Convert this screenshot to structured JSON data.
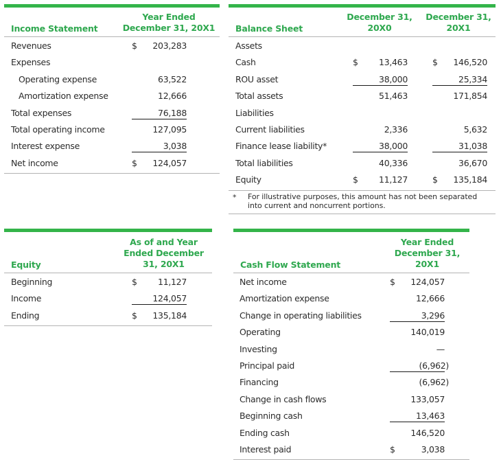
{
  "accent_color": "#34b44a",
  "income_statement": {
    "title": "Income Statement",
    "column_header": "Year Ended December 31, 20X1",
    "column_header_lines": [
      "Year Ended",
      "December 31, 20X1"
    ],
    "rows": [
      {
        "label": "Revenues",
        "currency": "$",
        "value": "203,283",
        "underline": false,
        "indent": false
      },
      {
        "label": "Expenses",
        "currency": "",
        "value": "",
        "underline": false,
        "indent": false
      },
      {
        "label": "Operating expense",
        "currency": "",
        "value": "63,522",
        "underline": false,
        "indent": true
      },
      {
        "label": "Amortization expense",
        "currency": "",
        "value": "12,666",
        "underline": false,
        "indent": true
      },
      {
        "label": "Total expenses",
        "currency": "",
        "value": "76,188",
        "underline": true,
        "indent": false
      },
      {
        "label": "Total operating income",
        "currency": "",
        "value": "127,095",
        "underline": false,
        "indent": false
      },
      {
        "label": "Interest expense",
        "currency": "",
        "value": "3,038",
        "underline": true,
        "indent": false
      },
      {
        "label": "Net income",
        "currency": "$",
        "value": "124,057",
        "underline": false,
        "indent": false
      }
    ]
  },
  "balance_sheet": {
    "title": "Balance Sheet",
    "column_headers": [
      {
        "lines": [
          "December 31,",
          "20X0"
        ]
      },
      {
        "lines": [
          "December 31,",
          "20X1"
        ]
      }
    ],
    "rows": [
      {
        "label": "Assets",
        "cells": [
          {
            "currency": "",
            "value": "",
            "underline": false
          },
          {
            "currency": "",
            "value": "",
            "underline": false
          }
        ]
      },
      {
        "label": "Cash",
        "cells": [
          {
            "currency": "$",
            "value": "13,463",
            "underline": false
          },
          {
            "currency": "$",
            "value": "146,520",
            "underline": false
          }
        ]
      },
      {
        "label": "ROU asset",
        "cells": [
          {
            "currency": "",
            "value": "38,000",
            "underline": true
          },
          {
            "currency": "",
            "value": "25,334",
            "underline": true
          }
        ]
      },
      {
        "label": "Total assets",
        "cells": [
          {
            "currency": "",
            "value": "51,463",
            "underline": false
          },
          {
            "currency": "",
            "value": "171,854",
            "underline": false
          }
        ]
      },
      {
        "label": "Liabilities",
        "cells": [
          {
            "currency": "",
            "value": "",
            "underline": false
          },
          {
            "currency": "",
            "value": "",
            "underline": false
          }
        ]
      },
      {
        "label": "Current liabilities",
        "cells": [
          {
            "currency": "",
            "value": "2,336",
            "underline": false
          },
          {
            "currency": "",
            "value": "5,632",
            "underline": false
          }
        ]
      },
      {
        "label": "Finance lease liability*",
        "cells": [
          {
            "currency": "",
            "value": "38,000",
            "underline": true
          },
          {
            "currency": "",
            "value": "31,038",
            "underline": true
          }
        ]
      },
      {
        "label": "Total liabilities",
        "cells": [
          {
            "currency": "",
            "value": "40,336",
            "underline": false
          },
          {
            "currency": "",
            "value": "36,670",
            "underline": false
          }
        ]
      },
      {
        "label": "Equity",
        "cells": [
          {
            "currency": "$",
            "value": "11,127",
            "underline": false
          },
          {
            "currency": "$",
            "value": "135,184",
            "underline": false
          }
        ]
      }
    ],
    "footnote": {
      "marker": "*",
      "lines": [
        "For illustrative purposes, this amount has not been separated",
        "into current and noncurrent portions."
      ]
    }
  },
  "equity": {
    "title": "Equity",
    "column_header_lines": [
      "As of and Year",
      "Ended December",
      "31, 20X1"
    ],
    "rows": [
      {
        "label": "Beginning",
        "currency": "$",
        "value": "11,127",
        "underline": false
      },
      {
        "label": "Income",
        "currency": "",
        "value": "124,057",
        "underline": true
      },
      {
        "label": "Ending",
        "currency": "$",
        "value": "135,184",
        "underline": false
      }
    ]
  },
  "cash_flow_statement": {
    "title": "Cash Flow Statement",
    "column_header_lines": [
      "Year Ended",
      "December 31,",
      "20X1"
    ],
    "rows": [
      {
        "label": "Net income",
        "currency": "$",
        "value": "124,057",
        "underline": false,
        "paren": false
      },
      {
        "label": "Amortization expense",
        "currency": "",
        "value": "12,666",
        "underline": false,
        "paren": false
      },
      {
        "label": "Change in operating liabilities",
        "currency": "",
        "value": "3,296",
        "underline": true,
        "paren": false
      },
      {
        "label": "Operating",
        "currency": "",
        "value": "140,019",
        "underline": false,
        "paren": false
      },
      {
        "label": "Investing",
        "currency": "",
        "value": "—",
        "underline": false,
        "paren": false
      },
      {
        "label": "Principal paid",
        "currency": "",
        "value": "(6,962)",
        "underline": true,
        "paren": true
      },
      {
        "label": "Financing",
        "currency": "",
        "value": "(6,962)",
        "underline": false,
        "paren": true
      },
      {
        "label": "Change in cash flows",
        "currency": "",
        "value": "133,057",
        "underline": false,
        "paren": false
      },
      {
        "label": "Beginning cash",
        "currency": "",
        "value": "13,463",
        "underline": true,
        "paren": false
      },
      {
        "label": "Ending cash",
        "currency": "",
        "value": "146,520",
        "underline": false,
        "paren": false
      },
      {
        "label": "Interest paid",
        "currency": "$",
        "value": "3,038",
        "underline": false,
        "paren": false
      }
    ]
  }
}
